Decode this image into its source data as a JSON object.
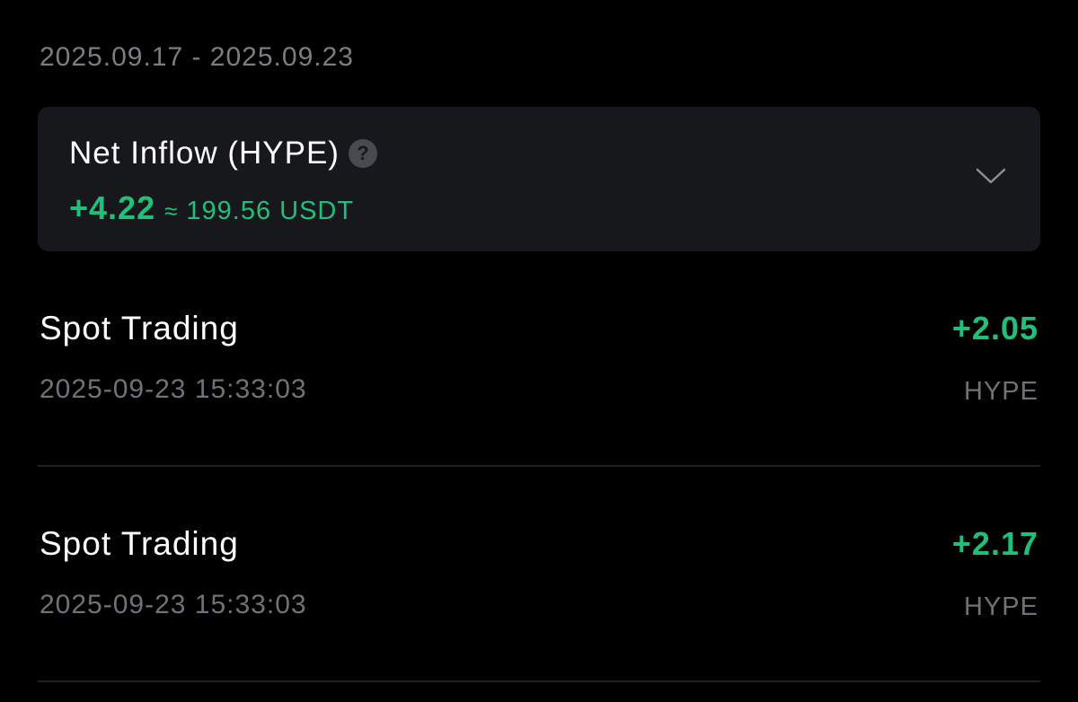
{
  "date_range": "2025.09.17 - 2025.09.23",
  "summary": {
    "title": "Net Inflow (HYPE)",
    "help_icon": "question-circle-icon",
    "net_amount": "+4.22",
    "approx_symbol": "≈",
    "usdt_value": "199.56 USDT",
    "expand_icon": "chevron-down-icon"
  },
  "transactions": [
    {
      "type": "Spot Trading",
      "amount": "+2.05",
      "time": "2025-09-23 15:33:03",
      "unit": "HYPE"
    },
    {
      "type": "Spot Trading",
      "amount": "+2.17",
      "time": "2025-09-23 15:33:03",
      "unit": "HYPE"
    }
  ],
  "colors": {
    "background": "#000000",
    "card": "#16181c",
    "positive": "#21c07a",
    "muted_text": "#6f7277"
  }
}
